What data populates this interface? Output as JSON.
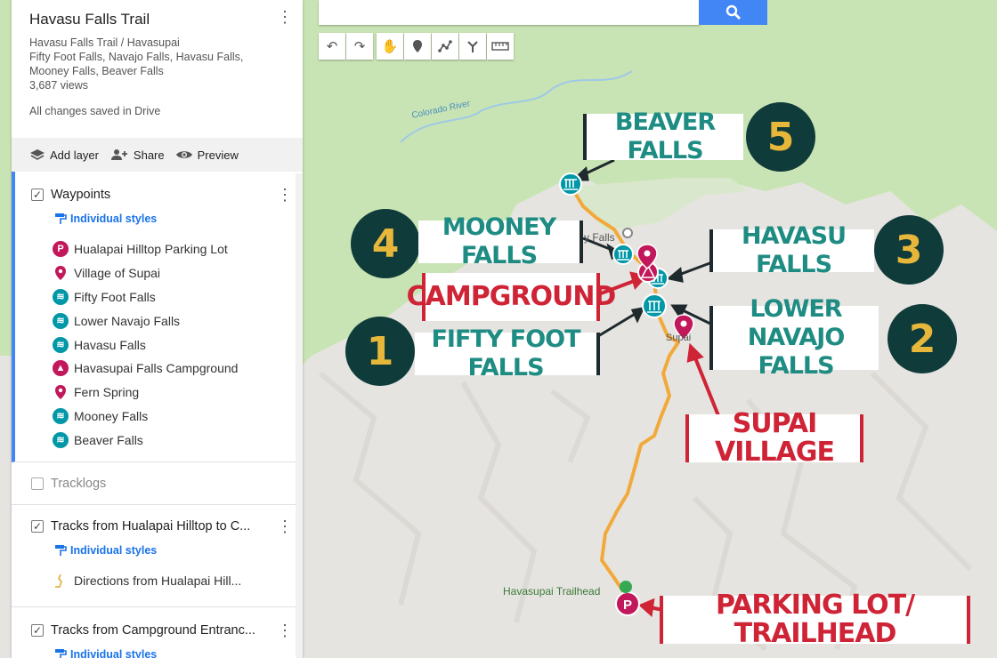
{
  "map": {
    "title": "Havasu Falls Trail",
    "meta_lines": [
      "Havasu Falls Trail / Havasupai",
      "Fifty Foot Falls, Navajo Falls, Havasu Falls,",
      "Mooney Falls, Beaver Falls",
      "3,687 views"
    ],
    "saved_status": "All changes saved in Drive"
  },
  "actions": {
    "add_layer": "Add layer",
    "share": "Share",
    "preview": "Preview"
  },
  "layers": [
    {
      "name": "Waypoints",
      "checked": true,
      "styles_label": "Individual styles",
      "items": [
        {
          "label": "Hualapai Hilltop Parking Lot",
          "icon": "parking-icon",
          "color": "#c2185b"
        },
        {
          "label": "Village of Supai",
          "icon": "pin-icon",
          "color": "#c2185b"
        },
        {
          "label": "Fifty Foot Falls",
          "icon": "waterfall-icon",
          "color": "#0097a7"
        },
        {
          "label": "Lower Navajo Falls",
          "icon": "waterfall-icon",
          "color": "#0097a7"
        },
        {
          "label": "Havasu Falls",
          "icon": "waterfall-icon",
          "color": "#0097a7"
        },
        {
          "label": "Havasupai Falls Campground",
          "icon": "campground-icon",
          "color": "#c2185b"
        },
        {
          "label": "Fern Spring",
          "icon": "pin-icon",
          "color": "#c2185b"
        },
        {
          "label": "Mooney Falls",
          "icon": "waterfall-icon",
          "color": "#0097a7"
        },
        {
          "label": "Beaver Falls",
          "icon": "waterfall-icon",
          "color": "#0097a7"
        }
      ]
    },
    {
      "name": "Tracklogs",
      "checked": false
    },
    {
      "name": "Tracks from Hualapai Hilltop to C...",
      "checked": true,
      "styles_label": "Individual styles",
      "items": [
        {
          "label": "Directions from Hualapai Hill...",
          "icon": "directions-icon"
        }
      ]
    },
    {
      "name": "Tracks from Campground Entranc...",
      "checked": true,
      "styles_label": "Individual styles"
    }
  ],
  "map_labels": {
    "colorado_river": "Colorado River",
    "mooney_falls_partial": "y Falls",
    "supai_partial": "Supai",
    "trailhead": "Havasupai Trailhead"
  },
  "callouts": {
    "beaver_falls": "BEAVER FALLS",
    "mooney_falls": "MOONEY FALLS",
    "havasu_falls": "HAVASU FALLS",
    "campground": "CAMPGROUND",
    "lower_navajo_l1": "LOWER NAVAJO",
    "lower_navajo_l2": "FALLS",
    "fifty_foot_falls": "FIFTY FOOT FALLS",
    "supai_village": "SUPAI VILLAGE",
    "parking_lot": "PARKING LOT/ TRAILHEAD",
    "num1": "1",
    "num2": "2",
    "num3": "3",
    "num4": "4",
    "num5": "5"
  },
  "colors": {
    "teal_text": "#1e8c83",
    "red_text": "#cf2336",
    "number_bg": "#0f3b3a",
    "number_fg": "#e6b73a",
    "trail": "#f2a93b",
    "accent": "#4285f4"
  }
}
